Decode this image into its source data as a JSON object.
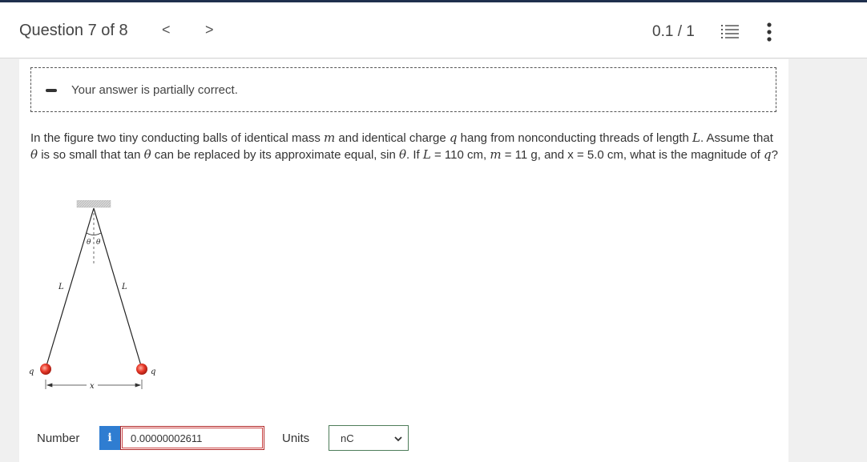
{
  "header": {
    "title": "Question 7 of 8",
    "prev": "<",
    "next": ">",
    "score": "0.1 / 1",
    "icons": [
      "list-icon",
      "more-vertical-icon"
    ]
  },
  "feedback": {
    "message": "Your answer is partially correct."
  },
  "problem": {
    "p1": "In the figure two tiny conducting balls of identical mass ",
    "m": "m",
    "p2": " and identical charge ",
    "q": "q",
    "p3": " hang from nonconducting threads of length ",
    "L": "L",
    "p4": ". Assume that ",
    "theta": "θ",
    "p5": " is so small that tan ",
    "p6": " can be replaced by its approximate equal, sin ",
    "p7": ". If ",
    "p8": " = 110 cm, ",
    "p9": " = 11 g, and x = 5.0 cm, what is the magnitude of ",
    "p10": "?"
  },
  "figure": {
    "left_length": "L",
    "right_length": "L",
    "angle_left": "θ",
    "angle_right": "θ",
    "charge_left": "q",
    "charge_right": "q",
    "separation": "x"
  },
  "answer": {
    "number_label": "Number",
    "info": "i",
    "value": "0.00000002611",
    "units_label": "Units",
    "units_selected": "nC"
  },
  "colors": {
    "ball": "#e8392a",
    "info_button": "#2f7dd1",
    "input_border": "#b22a2a",
    "select_border": "#4e7d5a"
  }
}
